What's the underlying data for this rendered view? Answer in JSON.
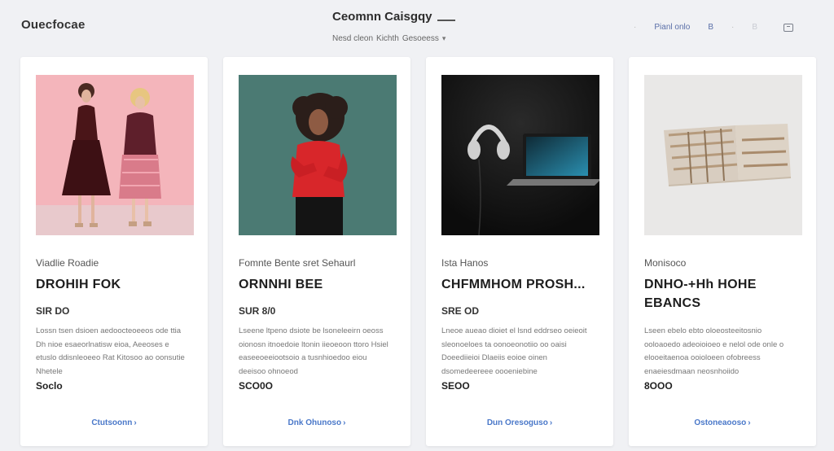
{
  "header": {
    "brand": "Ouecfocae",
    "title": "Ceomnn Caisgqy",
    "breadcrumb": [
      "Nesd cleon",
      "Kichth",
      "Gesoeess"
    ],
    "links": [
      "Pianl onlo",
      "B",
      "B"
    ]
  },
  "products": [
    {
      "category": "Viadlie Roadie",
      "title": "DROHIH FOK",
      "price": "SIR DO",
      "description": "Lossn tsen dsioen aedoocteoeeos ode ttia Dh nioe esaeorlnatisw eioa, Aeeoses e etuslo ddisnleoeeo Rat Kitosoo ao oonsutie Nhetele",
      "meta": "Soclo",
      "cta": "Ctutsoonn",
      "colors": {
        "bg": "#f4b5bb",
        "accent": "#5a1e24"
      }
    },
    {
      "category": "Fomnte Bente sret Sehaurl",
      "title": "ORNNHI BEE",
      "price": "SUR 8/0",
      "description": "Lseene ltpeno dsiote be lsoneleeirn oeoss oionosn itnoedoie ltonin iieoeoon ttoro Hsiel easeeoeeiootsoio a tusnhioedoo eiou deeisoo ohnoeod",
      "meta": "SCO0O",
      "cta": "Dnk Ohunoso",
      "colors": {
        "bg": "#4b7a73",
        "accent": "#d8262a"
      }
    },
    {
      "category": "Ista Hanos",
      "title": "CHFMMHOM PROSH...",
      "price": "SRE OD",
      "description": "Lneoe aueao dioiet el lsnd eddrseo oeieoit sleonoeloes ta oonoeonotiio oo oaisi Doeediieioi Dlaeiis eoioe oinen dsomedeereee oooeniebine",
      "meta": "SEOO",
      "cta": "Dun Oresoguso",
      "colors": {
        "bg": "#141414",
        "accent": "#2a8fb0"
      }
    },
    {
      "category": "Monisoco",
      "title": "DNHO-+Hh HOHE EBANCS",
      "price": "",
      "description": "Lseen ebelo ebto oloeosteeitosnio ooloaoedo adeoioioeo e nelol ode onle o elooeitaenoa ooioloeen ofobreess enaeiesdmaan neosnhoiido",
      "meta": "8OOO",
      "cta": "Ostoneaooso",
      "colors": {
        "bg": "#e9e8e7",
        "accent": "#b59a7c"
      }
    }
  ]
}
